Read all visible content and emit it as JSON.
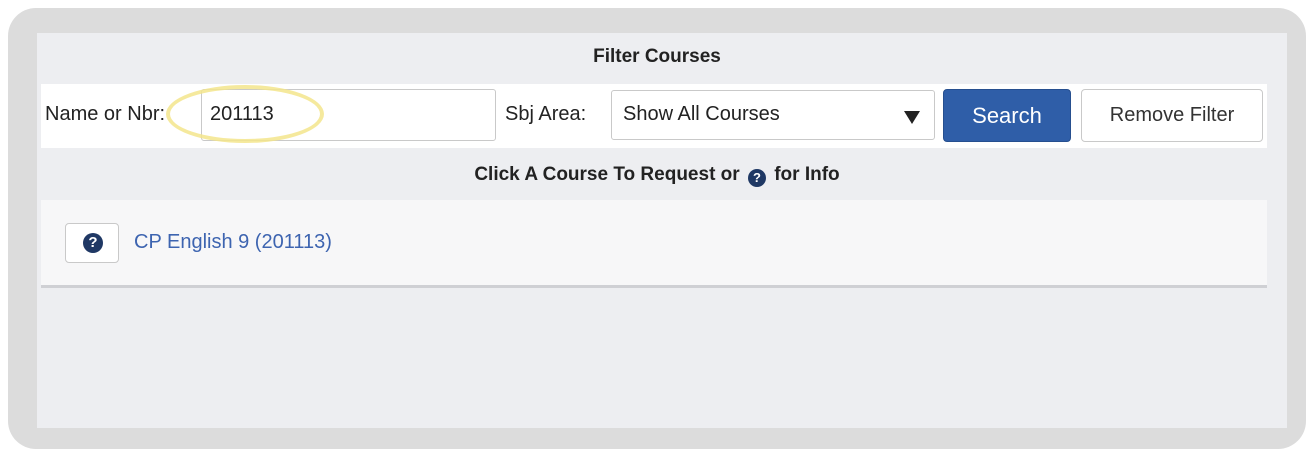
{
  "filter": {
    "title": "Filter Courses",
    "name_label": "Name or Nbr:",
    "name_value": "201113",
    "sbj_label": "Sbj Area:",
    "sbj_selected": "Show All Courses",
    "search_label": "Search",
    "remove_label": "Remove Filter"
  },
  "hint": {
    "before": "Click A Course To Request or",
    "icon": "question-circle-icon",
    "after": "for Info"
  },
  "courses": [
    {
      "label": "CP English 9 (201113)",
      "icon": "question-circle-icon"
    }
  ],
  "colors": {
    "primary_button": "#2f5ea8",
    "link": "#3d64b0",
    "highlight": "#f3e58c"
  }
}
